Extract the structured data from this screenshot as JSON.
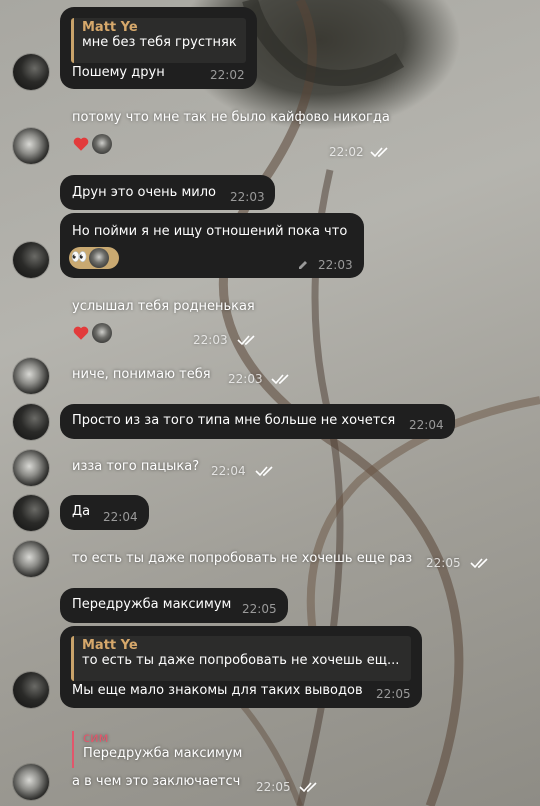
{
  "colors": {
    "bubble": "#1f1f1f",
    "reply_name": "#d6a86b",
    "reply_bar": "#c9a36a",
    "sim_name": "#e2566b",
    "heart": "#e23b3b"
  },
  "messages": [
    {
      "reply_name": "Matt Ye",
      "reply_text": "мне без тебя грустняк",
      "text": "Пошему друн",
      "time": "22:02"
    },
    {
      "text": "потому что мне так не было кайфово никогда",
      "time": "22:02",
      "reactions": [
        "heart-icon",
        "avatar"
      ]
    },
    {
      "text": "Друн это очень мило",
      "time": "22:03"
    },
    {
      "text": "Но пойми я не ищу отношений пока что",
      "time": "22:03",
      "edited_icon": "pencil-icon",
      "reactions": [
        "eyes-emoji",
        "avatar"
      ]
    },
    {
      "text": "услышал тебя родненькая",
      "time": "22:03",
      "reactions": [
        "heart-icon",
        "avatar"
      ]
    },
    {
      "text": "ниче, понимаю тебя",
      "time": "22:03"
    },
    {
      "text": "Просто из за того типа мне больше не хочется",
      "time": "22:04"
    },
    {
      "text": "изза того пацыка?",
      "time": "22:04"
    },
    {
      "text": "Да",
      "time": "22:04"
    },
    {
      "text": "то есть ты даже попробовать не хочешь еще раз",
      "time": "22:05"
    },
    {
      "text": "Передружба максимум",
      "time": "22:05"
    },
    {
      "reply_name": "Matt Ye",
      "reply_text": "то есть ты даже попробовать не хочешь ещ...",
      "text": "Мы еще мало знакомы для таких выводов",
      "time": "22:05"
    },
    {
      "reply_name": "сим",
      "reply_text": "Передружба максимум",
      "text": "а в чем это заключаетсч",
      "time": "22:05"
    }
  ]
}
